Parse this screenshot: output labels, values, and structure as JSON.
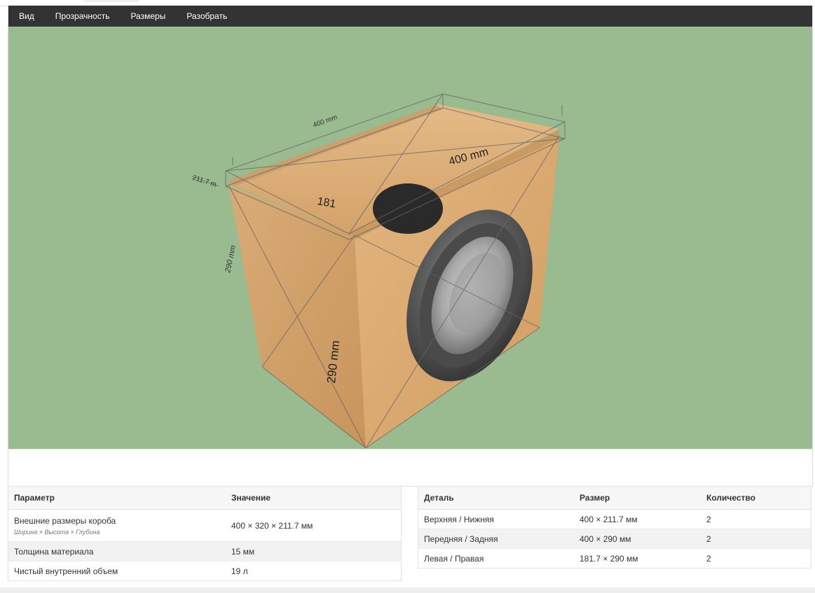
{
  "menu": {
    "view": "Вид",
    "transparency": "Прозрачность",
    "sizes": "Размеры",
    "disassemble": "Разобрать"
  },
  "scene": {
    "dim_top_width": "400 mm",
    "dim_top_inner": "400 mm",
    "dim_top_depth": "181",
    "dim_side_depth": "211.7 m",
    "dim_left_height": "290 mm",
    "dim_front_height": "290 mm",
    "colors": {
      "background": "#9aba8f",
      "wood": "#d9ab74",
      "speaker": "#3b3b3b"
    }
  },
  "params": {
    "headers": [
      "Параметр",
      "Значение"
    ],
    "rows": [
      {
        "name": "Внешние размеры короба",
        "sub": "Ширина × Высота × Глубина",
        "value": "400 × 320 × 211.7 мм"
      },
      {
        "name": "Толщина материала",
        "value": "15 мм"
      },
      {
        "name": "Чистый внутренний объем",
        "value": "19 л"
      }
    ]
  },
  "parts": {
    "headers": [
      "Деталь",
      "Размер",
      "Количество"
    ],
    "rows": [
      {
        "name": "Верхняя / Нижняя",
        "size": "400 × 211.7 мм",
        "qty": "2"
      },
      {
        "name": "Передняя / Задняя",
        "size": "400 × 290 мм",
        "qty": "2"
      },
      {
        "name": "Левая / Правая",
        "size": "181.7 × 290 мм",
        "qty": "2"
      }
    ]
  }
}
